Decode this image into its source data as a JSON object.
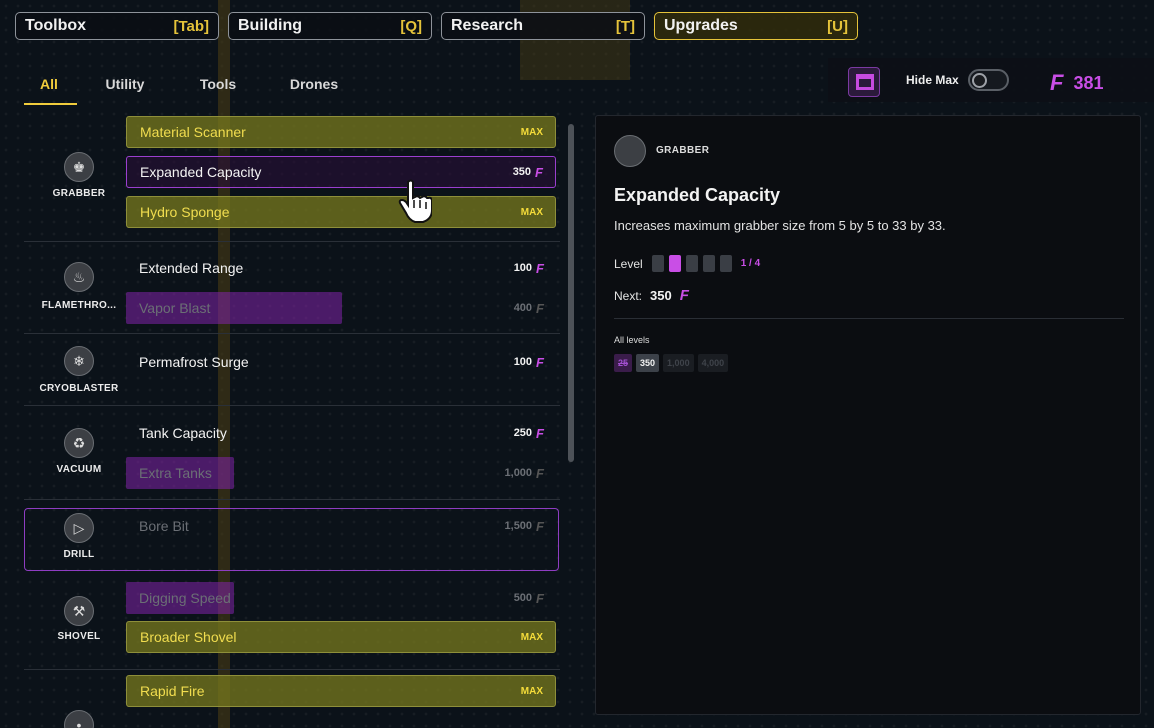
{
  "toolbar": {
    "tabs": [
      {
        "label": "Toolbox",
        "key": "[Tab]"
      },
      {
        "label": "Building",
        "key": "[Q]"
      },
      {
        "label": "Research",
        "key": "[T]"
      },
      {
        "label": "Upgrades",
        "key": "[U]"
      }
    ],
    "active_tab": "Upgrades"
  },
  "categories": [
    "All",
    "Utility",
    "Tools",
    "Drones"
  ],
  "active_category": "All",
  "header": {
    "hide_max_label": "Hide Max",
    "hide_max_on": false,
    "currency_glyph": "F",
    "currency_value": "381"
  },
  "groups": [
    {
      "name": "GRABBER",
      "icon": "grabber-icon",
      "items": [
        {
          "label": "Material Scanner",
          "status": "MAX"
        },
        {
          "label": "Expanded Capacity",
          "cost": "350",
          "selected": true
        },
        {
          "label": "Hydro Sponge",
          "status": "MAX"
        }
      ]
    },
    {
      "name": "FLAMETHRO...",
      "icon": "flamethrower-icon",
      "items": [
        {
          "label": "Extended Range",
          "cost": "100"
        },
        {
          "label": "Vapor Blast",
          "cost": "400",
          "progress": 0.51
        }
      ]
    },
    {
      "name": "CRYOBLASTER",
      "icon": "cryoblaster-icon",
      "items": [
        {
          "label": "Permafrost Surge",
          "cost": "100"
        }
      ]
    },
    {
      "name": "VACUUM",
      "icon": "vacuum-icon",
      "items": [
        {
          "label": "Tank Capacity",
          "cost": "250"
        },
        {
          "label": "Extra Tanks",
          "cost": "1,000",
          "progress": 0.25
        }
      ]
    },
    {
      "name": "DRILL",
      "icon": "drill-icon",
      "items": [
        {
          "label": "Bore Bit",
          "cost": "1,500"
        }
      ]
    },
    {
      "name": "SHOVEL",
      "icon": "shovel-icon",
      "items": [
        {
          "label": "Digging Speed",
          "cost": "500",
          "progress": 0.25
        },
        {
          "label": "Broader Shovel",
          "status": "MAX"
        }
      ]
    },
    {
      "name": "",
      "icon": "gun-icon",
      "items": [
        {
          "label": "Rapid Fire",
          "status": "MAX"
        }
      ]
    }
  ],
  "detail": {
    "category": "GRABBER",
    "title": "Expanded Capacity",
    "description": "Increases maximum grabber size from 5 by 5 to 33 by 33.",
    "level_label": "Level",
    "level_current": 1,
    "level_max": 4,
    "level_text": "1 / 4",
    "next_label": "Next:",
    "next_cost": "350",
    "all_levels_label": "All levels",
    "all_levels": [
      "25",
      "350",
      "1,000",
      "4,000"
    ]
  },
  "colors": {
    "accent_yellow": "#f0cc3c",
    "accent_purple": "#c94ee6"
  }
}
